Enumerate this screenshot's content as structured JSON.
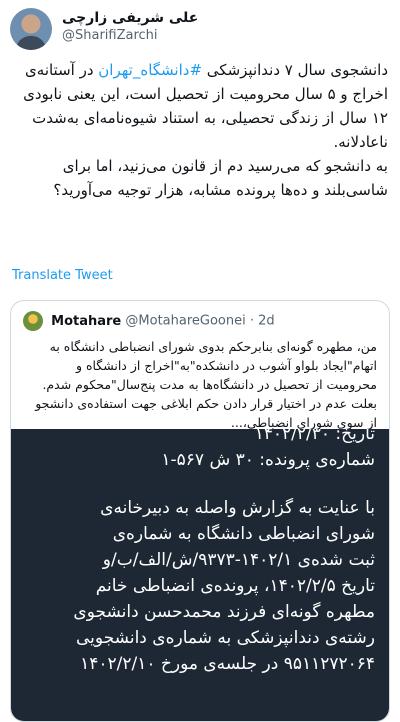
{
  "author": {
    "display_name": "علی شریفی زارچی",
    "handle": "@SharifiZarchi"
  },
  "tweet": {
    "p1_before": "دانشجوی سال ۷ دندانپزشکی ",
    "hashtag": "#دانشگاه_تهران",
    "p1_after": " در آستانه‌ی اخراج و ۵ سال محرومیت از تحصیل است، این یعنی نابودی ۱۲ سال از زندگی تحصیلی، به استناد شیوه‌نامه‌ای به‌شدت ناعادلانه.",
    "p2": "به دانشجو که می‌رسید دم از قانون می‌زنید، اما برای شاسی‌بلند و ده‌ها پرونده مشابه، هزار توجیه می‌آورید؟"
  },
  "translate_label": "Translate Tweet",
  "quote": {
    "name": "Motahare",
    "handle": "@MotahareGoonei",
    "time": "· 2d",
    "text": "من، مطهره گونه‌ای بنابرحکم بدوی شورای انضباطی دانشگاه به اتهام\"ایجاد بلواو آشوب در دانشکده\"به\"اخراج از دانشگاه و محرومیت از تحصیل در دانشگاه‌ها به مدت پنج‌سال\"محکوم شدم. بعلت عدم در اختیار قرار دادن حکم ابلاغی جهت استفاده‌ی دانشجو از سوی شورای انضباطی،..."
  },
  "document": {
    "lines": [
      "تاریخ: ۱۴۰۲/۲/۳۰",
      "شماره‌ی پرونده: ۳۰ ش ۵۶۷-۱",
      "",
      "با عنایت به گزارش واصله به دبیرخانه‌ی",
      "شورای انضباطی دانشگاه به شماره‌ی",
      "ثبت شده‌ی ۱۴۰۲/۱-۹۳۷۳/ش/الف/ب/و",
      "تاریخ ۱۴۰۲/۲/۵، پرونده‌ی انضباطی خانم",
      "مطهره گونه‌ای فرزند محمدحسن دانشجوی",
      "رشته‌ی دندانپزشکی به شماره‌ی دانشجویی",
      "۹۵۱۱۲۷۲۰۶۴ در جلسه‌ی مورخ ۱۴۰۲/۲/۱۰"
    ]
  }
}
